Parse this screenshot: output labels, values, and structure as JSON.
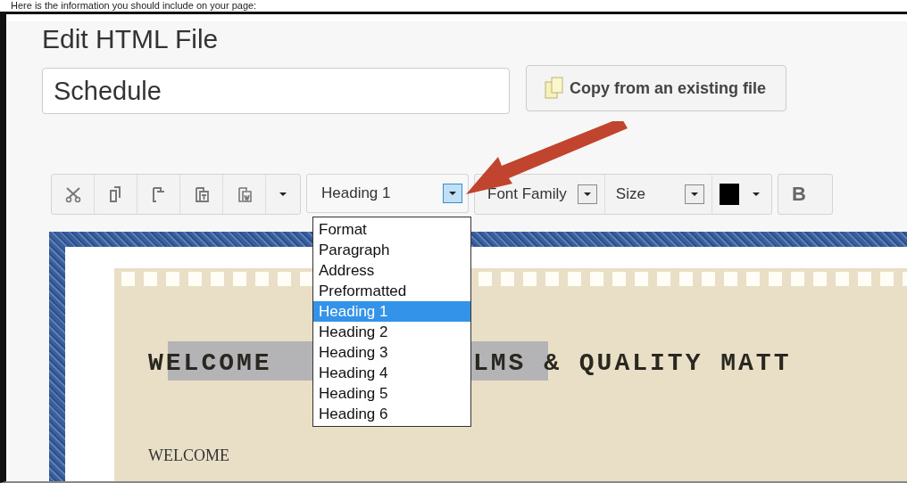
{
  "caption": "Here is the information you should include on your page:",
  "page_title": "Edit HTML File",
  "file_name": {
    "value": "Schedule"
  },
  "copy_button": {
    "label": "Copy from an existing file"
  },
  "toolbar": {
    "format_select": {
      "value": "Heading 1",
      "expanded": true
    },
    "font_family": {
      "value": "Font Family"
    },
    "size": {
      "value": "Size"
    },
    "bold": {
      "label": "B"
    }
  },
  "format_menu": [
    {
      "label": "Format",
      "selected": false
    },
    {
      "label": "Paragraph",
      "selected": false
    },
    {
      "label": "Address",
      "selected": false
    },
    {
      "label": "Preformatted",
      "selected": false
    },
    {
      "label": "Heading 1",
      "selected": true
    },
    {
      "label": "Heading 2",
      "selected": false
    },
    {
      "label": "Heading 3",
      "selected": false
    },
    {
      "label": "Heading 4",
      "selected": false
    },
    {
      "label": "Heading 5",
      "selected": false
    },
    {
      "label": "Heading 6",
      "selected": false
    }
  ],
  "document": {
    "heading_start": "WELCOME",
    "heading_end": "LMS & QUALITY MATT",
    "subheading": "WELCOME"
  }
}
